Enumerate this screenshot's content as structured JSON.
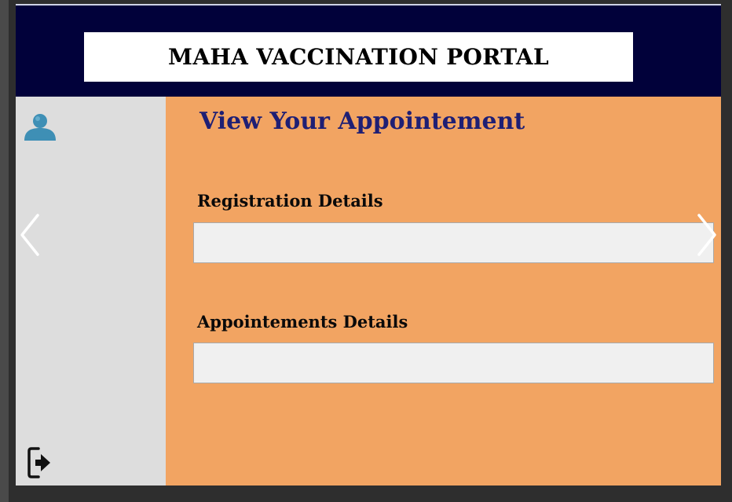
{
  "header": {
    "title": "MAHA VACCINATION PORTAL"
  },
  "sidebar": {
    "profile_icon": "user-icon",
    "logout_icon": "logout-icon"
  },
  "main": {
    "heading": "View Your Appointement",
    "sections": [
      {
        "label": "Registration Details",
        "value": ""
      },
      {
        "label": "Appointements Details",
        "value": ""
      }
    ]
  },
  "carousel": {
    "prev_icon": "chevron-left-icon",
    "next_icon": "chevron-right-icon"
  },
  "colors": {
    "header_bg": "#01013a",
    "main_bg": "#f2a462",
    "sidebar_bg": "#dddddd",
    "heading": "#1f1f74",
    "field_bg": "#f0f0f0",
    "user_icon": "#3e8fb5"
  }
}
